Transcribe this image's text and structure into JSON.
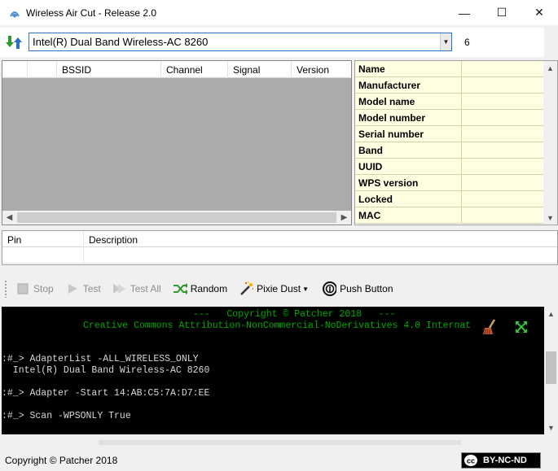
{
  "window": {
    "title": "Wireless Air Cut - Release 2.0",
    "minimize": "—",
    "maximize": "☐",
    "close": "✕"
  },
  "adapter": {
    "selected": "Intel(R) Dual Band Wireless-AC 8260",
    "count": "6"
  },
  "networks": {
    "columns": [
      "",
      "",
      "BSSID",
      "Channel",
      "Signal",
      "Version"
    ]
  },
  "info": {
    "rows": [
      {
        "key": "Name"
      },
      {
        "key": "Manufacturer"
      },
      {
        "key": "Model name"
      },
      {
        "key": "Model number"
      },
      {
        "key": "Serial number"
      },
      {
        "key": "Band"
      },
      {
        "key": "UUID"
      },
      {
        "key": "WPS version"
      },
      {
        "key": "Locked"
      },
      {
        "key": "MAC"
      }
    ]
  },
  "pins": {
    "col_pin": "Pin",
    "col_description": "Description"
  },
  "toolbar": {
    "stop": "Stop",
    "test": "Test",
    "test_all": "Test All",
    "random": "Random",
    "pixie_dust": "Pixie Dust",
    "push_button": "Push Button"
  },
  "console": {
    "header1": "---   Copyright © Patcher 2018   ---",
    "header2": "Creative Commons Attribution-NonCommercial-NoDerivatives 4.0 Internat",
    "line1": ":#_> AdapterList -ALL_WIRELESS_ONLY",
    "line2": "  Intel(R) Dual Band Wireless-AC 8260",
    "line3": ":#_> Adapter -Start 14:AB:C5:7A:D7:EE",
    "line4": ":#_> Scan -WPSONLY True"
  },
  "status": {
    "copyright": "Copyright © Patcher 2018",
    "license_badge": "BY-NC-ND"
  },
  "colors": {
    "console_bg": "#000000",
    "console_green": "#00a800",
    "info_bg": "#ffffe1",
    "grid_bg": "#ababab"
  }
}
